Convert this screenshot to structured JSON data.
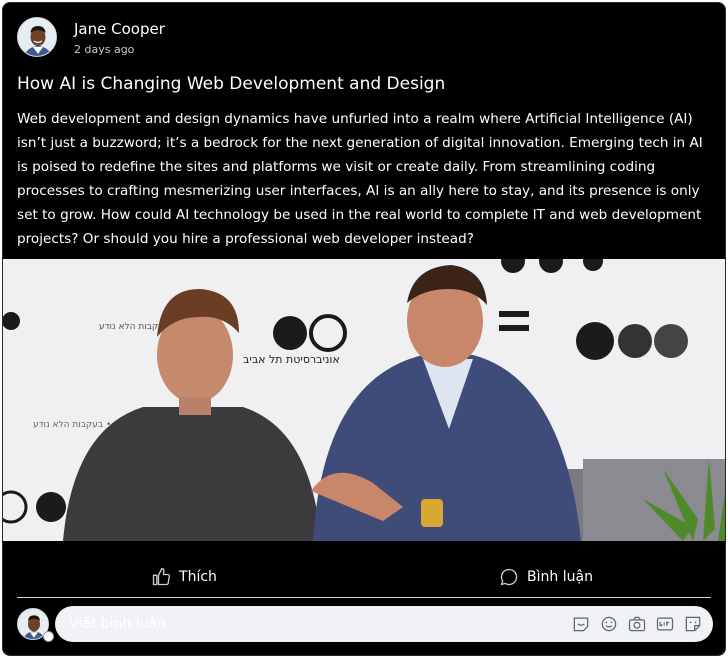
{
  "author": {
    "name": "Jane Cooper",
    "time": "2 days ago",
    "avatar_icon": "avatar-icon"
  },
  "post": {
    "title": "How AI is Changing Web Development and Design",
    "body": "Web development and design dynamics have unfurled into a realm where Artificial Intelligence (AI) isn’t just a buzzword; it’s a bedrock for the next generation of digital innovation. Emerging tech in AI is poised to redefine the sites and platforms we visit or create daily. From streamlining coding processes to crafting mesmerizing user interfaces, AI is an ally here to stay, and its presence is only set to grow. How could AI technology be used in the real world to complete IT and web development projects? Or should you hire a professional web developer instead?",
    "image_backdrop_text": {
      "university": "אוניברסיטת תל אביב",
      "tagline": "בעקבות הלא נודע •••"
    }
  },
  "actions": {
    "like_label": "Thích",
    "comment_label": "Bình luận"
  },
  "composer": {
    "placeholder": "Viết bình luận...",
    "icons": [
      "sticker-icon",
      "emoji-icon",
      "camera-icon",
      "gif-icon",
      "sticker-face-icon"
    ]
  },
  "colors": {
    "card_bg": "#000000",
    "text": "#ffffff",
    "input_bg": "#f0f2f5",
    "divider": "#d7d7d7"
  }
}
